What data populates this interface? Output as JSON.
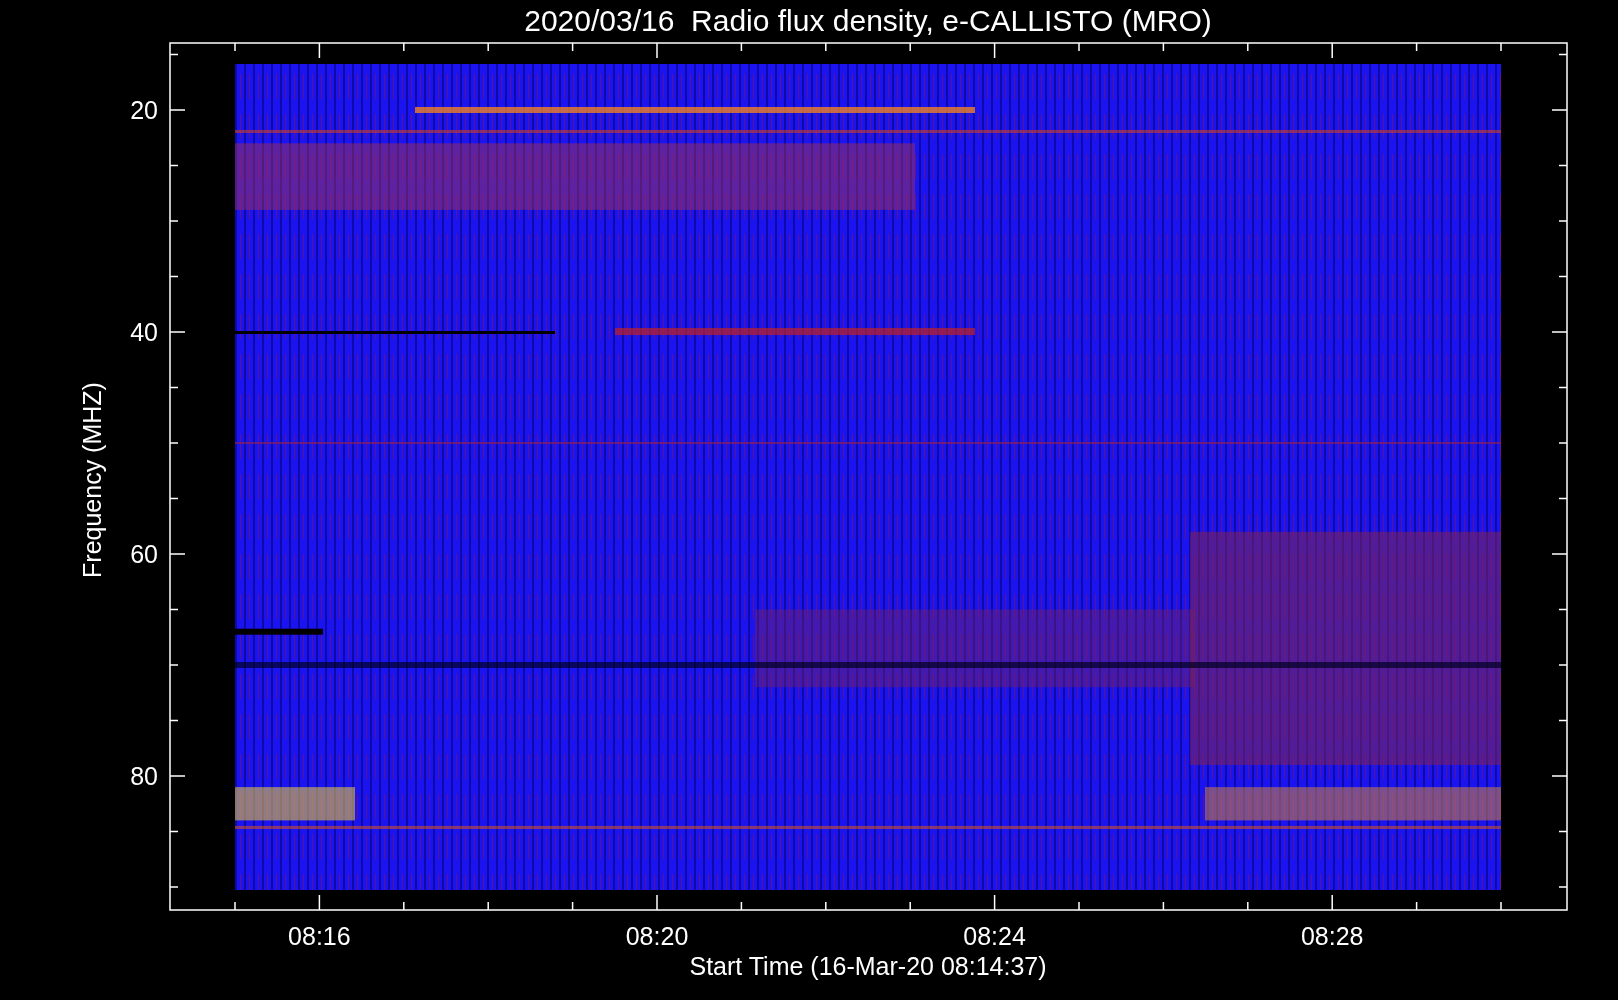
{
  "title": "2020/03/16  Radio flux density, e-CALLISTO (MRO)",
  "axes": {
    "ylabel": "Frequency (MHZ)",
    "xlabel": "Start Time (16-Mar-20 08:14:37)",
    "yticks": [
      "20",
      "40",
      "60",
      "80"
    ],
    "xticks": [
      "08:16",
      "08:20",
      "08:24",
      "08:28"
    ]
  }
}
